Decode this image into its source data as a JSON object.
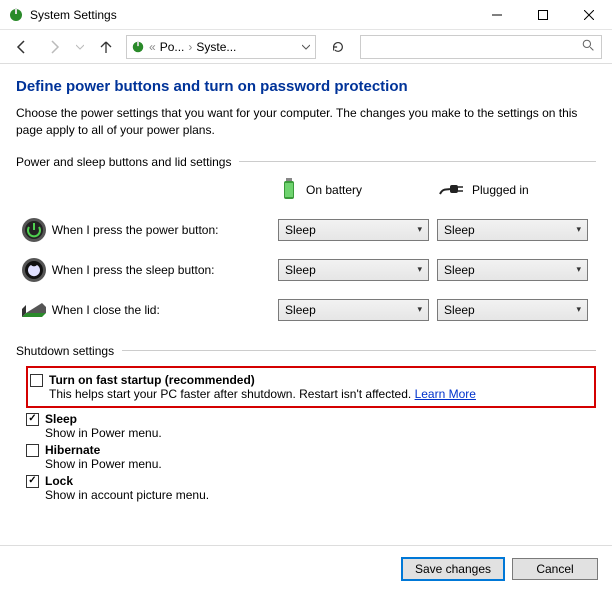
{
  "window": {
    "title": "System Settings"
  },
  "breadcrumb": {
    "item1": "Po...",
    "item2": "Syste..."
  },
  "page": {
    "title": "Define power buttons and turn on password protection",
    "description": "Choose the power settings that you want for your computer. The changes you make to the settings on this page apply to all of your power plans."
  },
  "section1": {
    "header": "Power and sleep buttons and lid settings",
    "col_battery": "On battery",
    "col_plugged": "Plugged in",
    "rows": [
      {
        "label": "When I press the power button:",
        "battery": "Sleep",
        "plugged": "Sleep"
      },
      {
        "label": "When I press the sleep button:",
        "battery": "Sleep",
        "plugged": "Sleep"
      },
      {
        "label": "When I close the lid:",
        "battery": "Sleep",
        "plugged": "Sleep"
      }
    ]
  },
  "section2": {
    "header": "Shutdown settings",
    "fast_startup": {
      "label": "Turn on fast startup (recommended)",
      "desc": "This helps start your PC faster after shutdown. Restart isn't affected. ",
      "link": "Learn More"
    },
    "sleep": {
      "label": "Sleep",
      "desc": "Show in Power menu."
    },
    "hibernate": {
      "label": "Hibernate",
      "desc": "Show in Power menu."
    },
    "lock": {
      "label": "Lock",
      "desc": "Show in account picture menu."
    }
  },
  "buttons": {
    "save": "Save changes",
    "cancel": "Cancel"
  }
}
